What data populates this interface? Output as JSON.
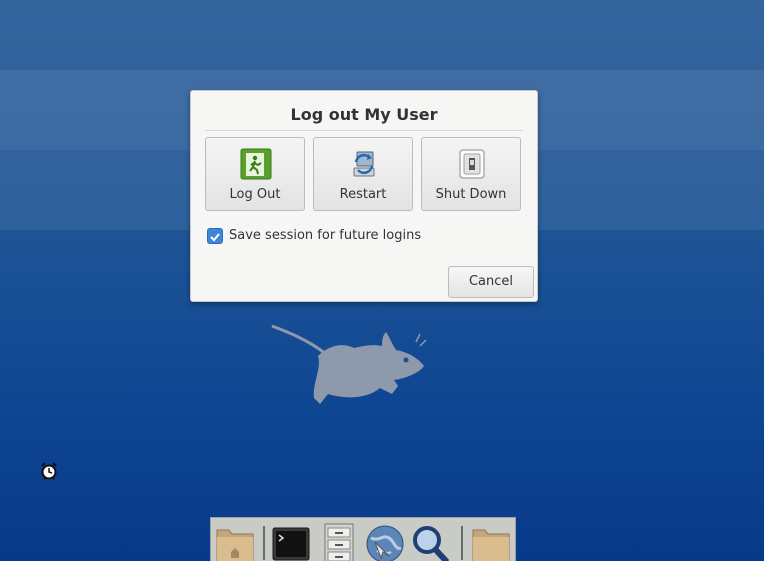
{
  "dialog": {
    "title": "Log out My User",
    "actions": [
      {
        "label": "Log Out",
        "icon": "exit-door-icon"
      },
      {
        "label": "Restart",
        "icon": "restart-icon"
      },
      {
        "label": "Shut Down",
        "icon": "power-switch-icon"
      }
    ],
    "save_session": {
      "label": "Save session for future logins",
      "checked": true
    },
    "cancel_label": "Cancel"
  },
  "desktop": {
    "wallpaper_icon": "xfce-mouse-logo",
    "icons": [
      "alarm-clock-icon"
    ]
  },
  "dock": {
    "items": [
      {
        "name": "home-folder-icon"
      },
      {
        "name": "terminal-icon"
      },
      {
        "name": "file-cabinet-icon"
      },
      {
        "name": "web-browser-icon"
      },
      {
        "name": "search-icon"
      },
      {
        "name": "folder-icon"
      }
    ]
  },
  "colors": {
    "desktop_top": "#2a5d98",
    "desktop_bottom": "#08398a",
    "dialog_bg": "#f6f6f5",
    "checkbox_accent": "#3f85d9"
  }
}
